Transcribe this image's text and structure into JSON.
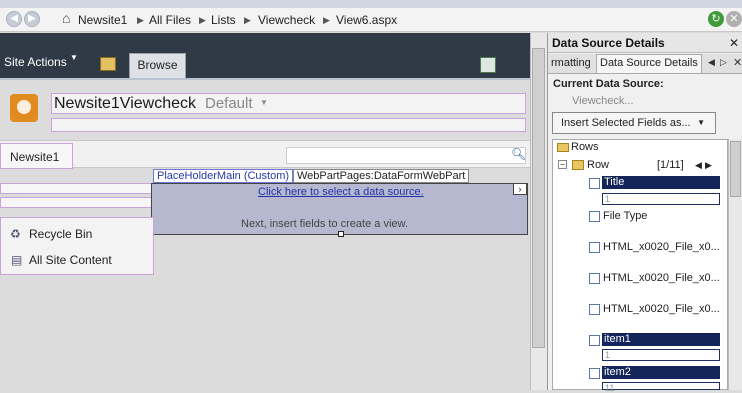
{
  "breadcrumb": {
    "items": [
      "Newsite1",
      "All Files",
      "Lists",
      "Viewcheck",
      "View6.aspx"
    ]
  },
  "ribbon": {
    "site_actions": "Site Actions",
    "browse_tab": "Browse"
  },
  "page": {
    "site_title": "Newsite1Viewcheck",
    "view_name": "Default",
    "nav_site": "Newsite1",
    "placeholder_main": "PlaceHolderMain (Custom)",
    "webpart_label": "WebPartPages:DataFormWebPart",
    "click_link": "Click here to select a data source.",
    "next_text": "Next, insert fields to create a view.",
    "quicklaunch": [
      "Recycle Bin",
      "All Site Content"
    ]
  },
  "panel": {
    "title": "Data Source Details",
    "tabs": [
      "rmatting",
      "Data Source Details"
    ],
    "current_source_label": "Current Data Source:",
    "current_source_value": "Viewcheck...",
    "insert_button": "Insert Selected Fields as...",
    "tree": {
      "rows": "Rows",
      "row": "Row",
      "row_index": "[1/11]",
      "fields": [
        {
          "name": "Title",
          "selected": true,
          "value": "1"
        },
        {
          "name": "File Type",
          "selected": false,
          "value": ""
        },
        {
          "name": "HTML_x0020_File_x0...",
          "selected": false,
          "value": ""
        },
        {
          "name": "HTML_x0020_File_x0...",
          "selected": false,
          "value": ""
        },
        {
          "name": "HTML_x0020_File_x0...",
          "selected": false,
          "value": ""
        },
        {
          "name": "item1",
          "selected": true,
          "value": "1"
        },
        {
          "name": "item2",
          "selected": true,
          "value": "11"
        }
      ]
    }
  }
}
